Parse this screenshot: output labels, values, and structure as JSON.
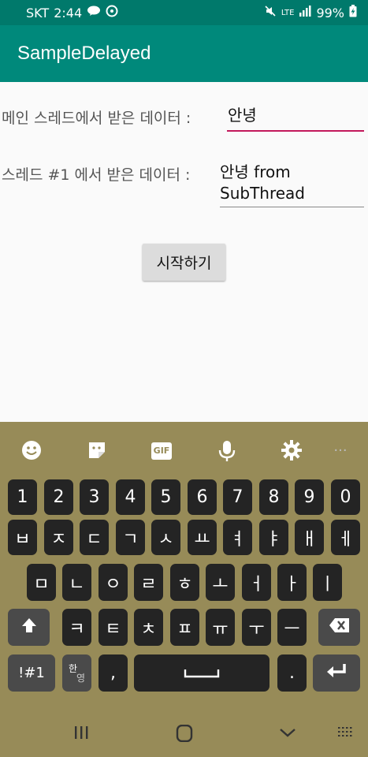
{
  "status_bar": {
    "carrier": "SKT",
    "time": "2:44",
    "network": "LTE",
    "battery": "99%"
  },
  "app_bar": {
    "title": "SampleDelayed"
  },
  "main": {
    "row1_label": "메인 스레드에서 받은 데이터 :",
    "row1_value": "안녕",
    "row2_label": "스레드 #1 에서 받은 데이터 :",
    "row2_value_line1": "안녕 from",
    "row2_value_line2": "SubThread",
    "start_button_label": "시작하기"
  },
  "keyboard": {
    "toolbar_gif": "GIF",
    "number_row": [
      "1",
      "2",
      "3",
      "4",
      "5",
      "6",
      "7",
      "8",
      "9",
      "0"
    ],
    "row1": [
      "ㅂ",
      "ㅈ",
      "ㄷ",
      "ㄱ",
      "ㅅ",
      "ㅛ",
      "ㅕ",
      "ㅑ",
      "ㅐ",
      "ㅔ"
    ],
    "row2": [
      "ㅁ",
      "ㄴ",
      "ㅇ",
      "ㄹ",
      "ㅎ",
      "ㅗ",
      "ㅓ",
      "ㅏ",
      "ㅣ"
    ],
    "row3": [
      "ㅋ",
      "ㅌ",
      "ㅊ",
      "ㅍ",
      "ㅠ",
      "ㅜ",
      "ㅡ"
    ],
    "symbols_key": "!#1",
    "lang_key_top": "한",
    "lang_key_bottom": "영",
    "comma_key": ",",
    "period_key": "."
  },
  "icons": {
    "shift": "shift-icon",
    "backspace": "backspace-icon",
    "enter": "enter-icon",
    "space": "space-icon"
  }
}
